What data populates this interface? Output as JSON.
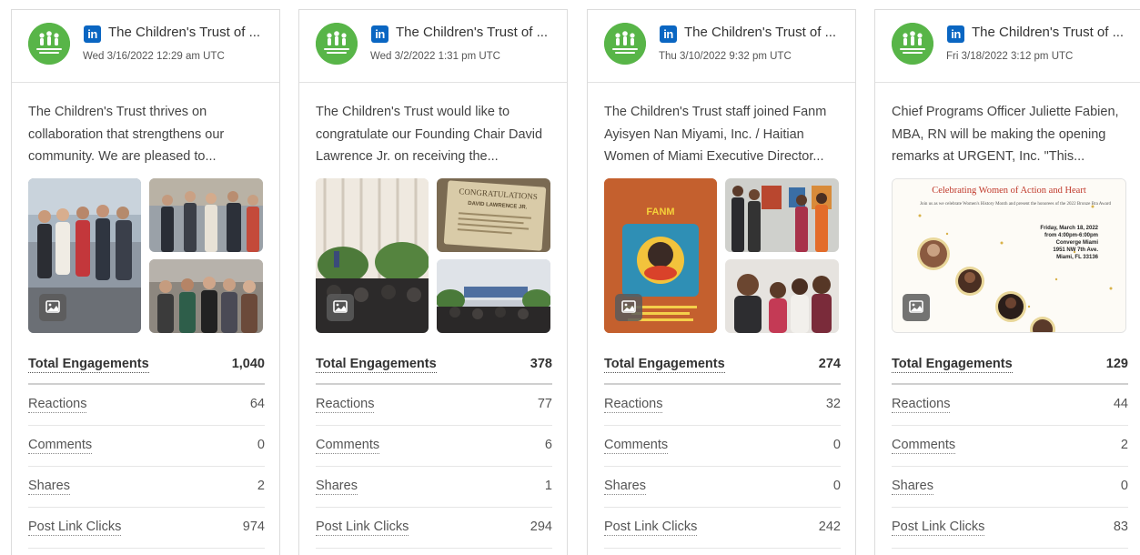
{
  "colors": {
    "brand_green": "#58b548",
    "linkedin_blue": "#0a66c2"
  },
  "icons": {
    "platform": "linkedin-icon",
    "media": "image-icon"
  },
  "posts": [
    {
      "account": "The Children's Trust of ...",
      "date": "Wed 3/16/2022 12:29 am UTC",
      "text": "The Children's Trust thrives on collaboration that strengthens our community. We are pleased to...",
      "stats": {
        "total_label": "Total Engagements",
        "total": "1,040",
        "reactions_label": "Reactions",
        "reactions": "64",
        "comments_label": "Comments",
        "comments": "0",
        "shares_label": "Shares",
        "shares": "2",
        "clicks_label": "Post Link Clicks",
        "clicks": "974"
      }
    },
    {
      "account": "The Children's Trust of ...",
      "date": "Wed 3/2/2022 1:31 pm UTC",
      "text": "The Children's Trust would like to congratulate our Founding Chair David Lawrence Jr. on receiving the...",
      "image_text": {
        "headline": "CONGRATULATIONS",
        "name": "DAVID LAWRENCE JR."
      },
      "stats": {
        "total_label": "Total Engagements",
        "total": "378",
        "reactions_label": "Reactions",
        "reactions": "77",
        "comments_label": "Comments",
        "comments": "6",
        "shares_label": "Shares",
        "shares": "1",
        "clicks_label": "Post Link Clicks",
        "clicks": "294"
      }
    },
    {
      "account": "The Children's Trust of ...",
      "date": "Thu 3/10/2022 9:32 pm UTC",
      "text": "The Children's Trust staff joined Fanm Ayisyen Nan Miyami, Inc. / Haitian Women of Miami Executive Director...",
      "image_text": {
        "headline": "FANM"
      },
      "stats": {
        "total_label": "Total Engagements",
        "total": "274",
        "reactions_label": "Reactions",
        "reactions": "32",
        "comments_label": "Comments",
        "comments": "0",
        "shares_label": "Shares",
        "shares": "0",
        "clicks_label": "Post Link Clicks",
        "clicks": "242"
      }
    },
    {
      "account": "The Children's Trust of ...",
      "date": "Fri 3/18/2022 3:12 pm UTC",
      "text": "Chief Programs Officer Juliette Fabien, MBA, RN will be making the opening remarks at URGENT, Inc. \"This...",
      "image_text": {
        "headline": "Celebrating Women of Action and Heart",
        "subline": "Join us as we celebrate Women's History Month and present the honorees of the 2022 Bronze Bra Award",
        "event_date": "Friday, March 18, 2022",
        "event_time": "from 4:00pm-6:00pm",
        "venue": "Converge Miami",
        "address": "1951 NW 7th Ave.",
        "city": "Miami, FL 33136"
      },
      "stats": {
        "total_label": "Total Engagements",
        "total": "129",
        "reactions_label": "Reactions",
        "reactions": "44",
        "comments_label": "Comments",
        "comments": "2",
        "shares_label": "Shares",
        "shares": "0",
        "clicks_label": "Post Link Clicks",
        "clicks": "83"
      }
    }
  ]
}
